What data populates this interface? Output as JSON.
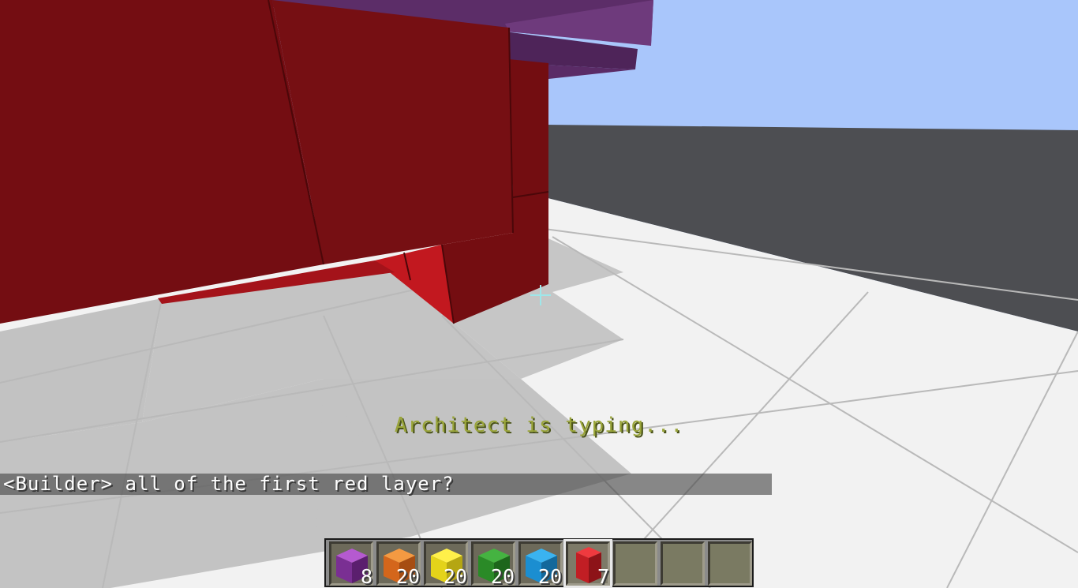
{
  "hud": {
    "typing_indicator": "Architect is typing...",
    "chat_message": "<Builder> all of the first red layer?"
  },
  "hotbar": {
    "slots": [
      {
        "block": "purple-block-icon",
        "color": "#8e3fa3",
        "count": "8"
      },
      {
        "block": "orange-block-icon",
        "color": "#e0751b",
        "count": "20"
      },
      {
        "block": "yellow-block-icon",
        "color": "#e8d31a",
        "count": "20"
      },
      {
        "block": "green-block-icon",
        "color": "#2d8d2a",
        "count": "20"
      },
      {
        "block": "blue-block-icon",
        "color": "#1b8ed1",
        "count": "20"
      },
      {
        "block": "red-block-icon",
        "color": "#c11e24",
        "count": "7",
        "selected": true
      },
      {
        "block": "empty-slot",
        "count": ""
      },
      {
        "block": "empty-slot",
        "count": ""
      },
      {
        "block": "empty-slot",
        "count": ""
      }
    ]
  },
  "colors": {
    "sky": "#a9c6fb",
    "red_block": "#7a0e12",
    "purple_block": "#5a2a66",
    "floor_white": "#f4f4f4",
    "floor_gray": "#c4c4c4",
    "void_gray": "#4a4b4e",
    "typing_text": "#9aa53a"
  }
}
